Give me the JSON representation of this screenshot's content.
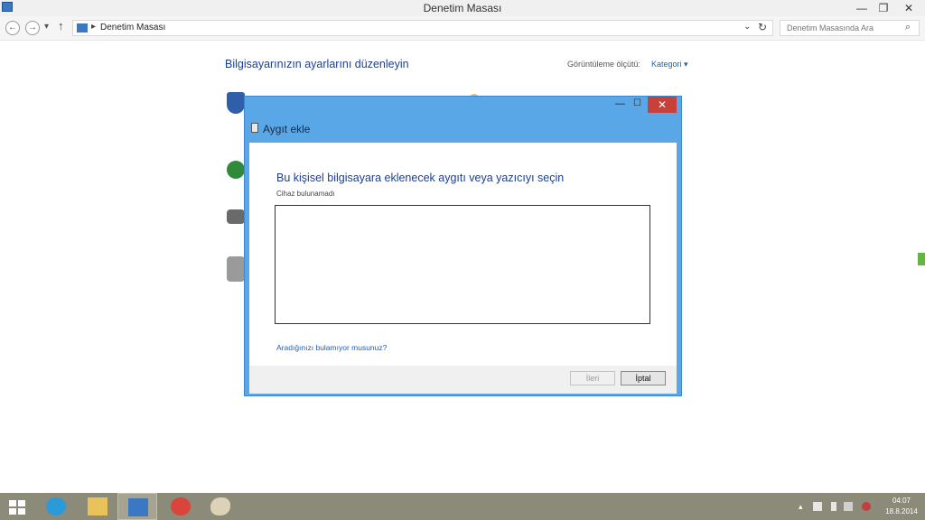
{
  "window": {
    "title": "Denetim Masası",
    "controls": {
      "minimize": "—",
      "restore": "❐",
      "close": "✕"
    }
  },
  "nav": {
    "back": "←",
    "forward": "→",
    "recent": "▾",
    "up": "↑",
    "breadcrumb_separator": "▸",
    "breadcrumb": "Denetim Masası",
    "address_dropdown": "⌄",
    "refresh": "↻",
    "search_placeholder": "Denetim Masasında Ara",
    "search_icon": "⌕"
  },
  "control_panel": {
    "heading": "Bilgisayarınızın ayarlarını düzenleyin",
    "view_by_label": "Görüntüleme ölçütü:",
    "view_by_value": "Kategori ▾"
  },
  "dialog": {
    "title": "Aygıt ekle",
    "controls": {
      "minimize": "—",
      "maximize": "☐",
      "close": "✕"
    },
    "heading": "Bu kişisel bilgisayara eklenecek aygıtı veya yazıcıyı seçin",
    "status": "Cihaz bulunamadı",
    "help_link": "Aradığınızı bulamıyor musunuz?",
    "buttons": {
      "next": "İleri",
      "cancel": "İptal"
    }
  },
  "taskbar": {
    "items": [
      "start",
      "internet-explorer",
      "file-explorer",
      "control-panel",
      "chrome",
      "paint"
    ],
    "active_item": "control-panel",
    "clock_time": "04:07",
    "clock_date": "18.8.2014"
  },
  "colors": {
    "dialog_frame": "#5aa7e8",
    "heading_blue": "#1e3f8c",
    "link_blue": "#1e5fb8",
    "taskbar": "#8c8a78",
    "close_red": "#c7413a"
  }
}
